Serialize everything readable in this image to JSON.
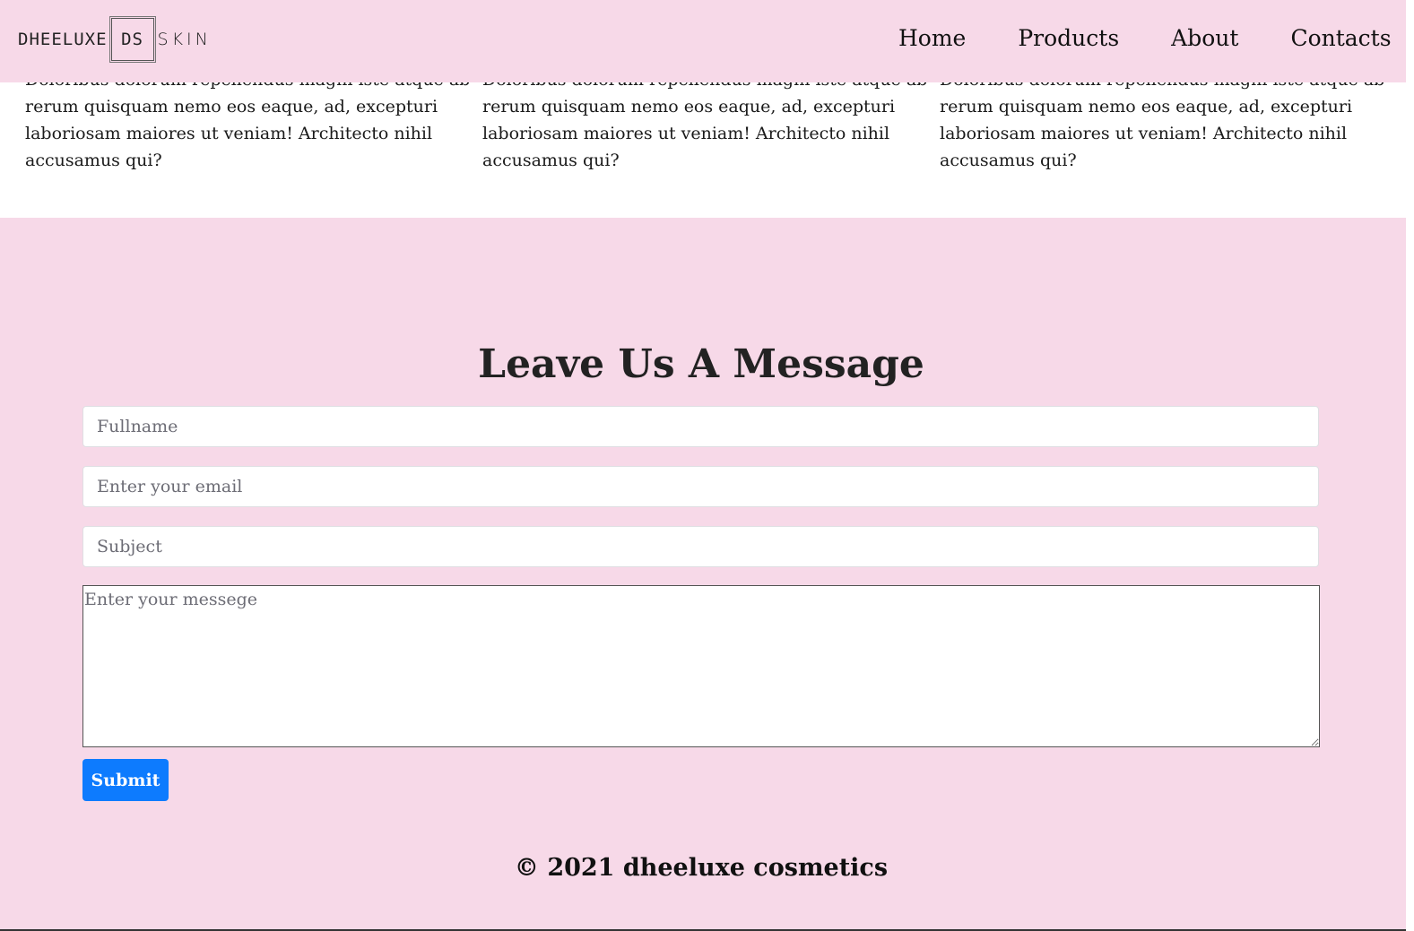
{
  "header": {
    "logo": {
      "left": "DHEELUXE",
      "box": "DS",
      "right": "SKIN"
    },
    "nav": [
      "Home",
      "Products",
      "About",
      "Contacts"
    ]
  },
  "articles": [
    {
      "cut_line": "Doloribus dolorum repellendus magni iste atque ab, nostr",
      "line1": "rerum quisquam nemo eos eaque, ad, excepturi",
      "line2": "laboriosam maiores ut veniam! Architecto nihil",
      "line3": "accusamus qui?"
    },
    {
      "cut_line": "Doloribus dolorum repellendus magni iste atque ab, nostr",
      "line1": "rerum quisquam nemo eos eaque, ad, excepturi",
      "line2": "laboriosam maiores ut veniam! Architecto nihil",
      "line3": "accusamus qui?"
    },
    {
      "cut_line": "Doloribus dolorum repellendus magni iste atque ab, nostr",
      "line1": "rerum quisquam nemo eos eaque, ad, excepturi",
      "line2": "laboriosam maiores ut veniam! Architecto nihil",
      "line3": "accusamus qui?"
    }
  ],
  "form": {
    "title": "Leave Us A Message",
    "fullname_placeholder": "Fullname",
    "email_placeholder": "Enter your email",
    "subject_placeholder": "Subject",
    "message_placeholder": "Enter your messege",
    "submit_label": "Submit"
  },
  "footer": {
    "text": "© 2021 dheeluxe cosmetics"
  },
  "colors": {
    "background_pink": "#f7d9e8",
    "button_blue": "#0d7bfe"
  }
}
